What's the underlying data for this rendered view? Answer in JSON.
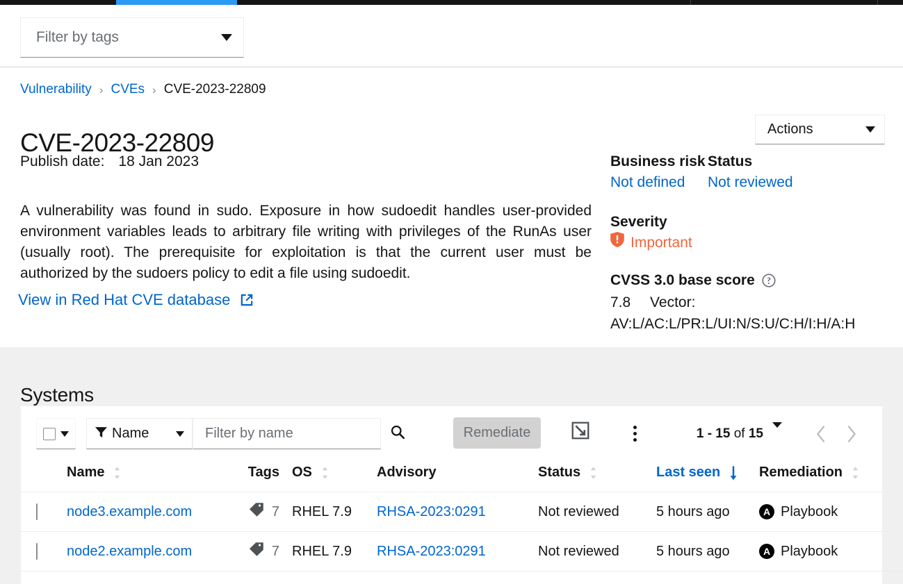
{
  "masthead": {
    "active_tab_indicator": true,
    "bg": "#151515",
    "accent": "#2b9af3"
  },
  "tag_filter": {
    "placeholder": "Filter by tags",
    "value": "Filter by tags",
    "icon": "chevron-down-icon"
  },
  "breadcrumb": {
    "items": [
      {
        "label": "Vulnerability",
        "link": true
      },
      {
        "label": "CVEs",
        "link": true
      },
      {
        "label": "CVE-2023-22809",
        "link": false
      }
    ],
    "separator": "›"
  },
  "header": {
    "title": "CVE-2023-22809",
    "publish_label": "Publish date:",
    "publish_value": "18 Jan 2023",
    "description": "A vulnerability was found in sudo. Exposure in how sudoedit handles user-provided environment variables leads to arbitrary file writing with privileges of the RunAs user (usually root). The prerequisite for exploitation is that the current user must be authorized by the sudoers policy to edit a file using sudoedit.",
    "external_link_label": "View in Red Hat CVE database",
    "external_link_icon": "external-link-icon"
  },
  "actions": {
    "label": "Actions",
    "icon": "chevron-down-icon"
  },
  "summary": {
    "business_risk_label": "Business risk",
    "business_risk_value": "Not defined",
    "status_label": "Status",
    "status_value": "Not reviewed",
    "severity_label": "Severity",
    "severity_value": "Important",
    "severity_icon": "severity-important-shield-icon",
    "severity_color": "#f0663c",
    "cvss_label": "CVSS 3.0 base score",
    "cvss_help_icon": "help-circle-icon",
    "cvss_score": "7.8",
    "cvss_vector_label": "Vector:",
    "cvss_vector": "AV:L/AC:L/PR:L/UI:N/S:U/C:H/I:H/A:H"
  },
  "systems": {
    "section_title": "Systems",
    "toolbar": {
      "bulk_select_icon": "checkbox-icon",
      "bulk_select_caret": "chevron-down-icon",
      "filter_icon": "filter-icon",
      "filter_category": "Name",
      "filter_caret": "chevron-down-icon",
      "search_placeholder": "Filter by name",
      "search_value": "",
      "search_icon": "search-icon",
      "remediate_label": "Remediate",
      "remediate_disabled": true,
      "expand_icon": "expand-icon",
      "kebab_icon": "kebab-vertical-icon",
      "pagination_range": "1 - 15",
      "pagination_of": "of",
      "pagination_total": "15",
      "pagination_caret": "chevron-down-icon",
      "prev_icon": "chevron-left-icon",
      "next_icon": "chevron-right-icon"
    },
    "columns": [
      {
        "label": "Name",
        "sortable": true,
        "sorted": false
      },
      {
        "label": "Tags",
        "sortable": false,
        "sorted": false
      },
      {
        "label": "OS",
        "sortable": true,
        "sorted": false
      },
      {
        "label": "Advisory",
        "sortable": false,
        "sorted": false
      },
      {
        "label": "Status",
        "sortable": true,
        "sorted": false
      },
      {
        "label": "Last seen",
        "sortable": true,
        "sorted": true,
        "direction": "desc"
      },
      {
        "label": "Remediation",
        "sortable": true,
        "sorted": false
      }
    ],
    "rows": [
      {
        "selected": false,
        "name": "node3.example.com",
        "tags_icon": "tag-icon",
        "tags_count": "7",
        "os": "RHEL 7.9",
        "advisory": "RHSA-2023:0291",
        "status": "Not reviewed",
        "last_seen": "5 hours ago",
        "remediation": "Playbook",
        "remediation_icon": "ansible-icon",
        "row_actions_icon": "kebab-vertical-icon"
      },
      {
        "selected": false,
        "name": "node2.example.com",
        "tags_icon": "tag-icon",
        "tags_count": "7",
        "os": "RHEL 7.9",
        "advisory": "RHSA-2023:0291",
        "status": "Not reviewed",
        "last_seen": "5 hours ago",
        "remediation": "Playbook",
        "remediation_icon": "ansible-icon",
        "row_actions_icon": "kebab-vertical-icon"
      }
    ]
  }
}
